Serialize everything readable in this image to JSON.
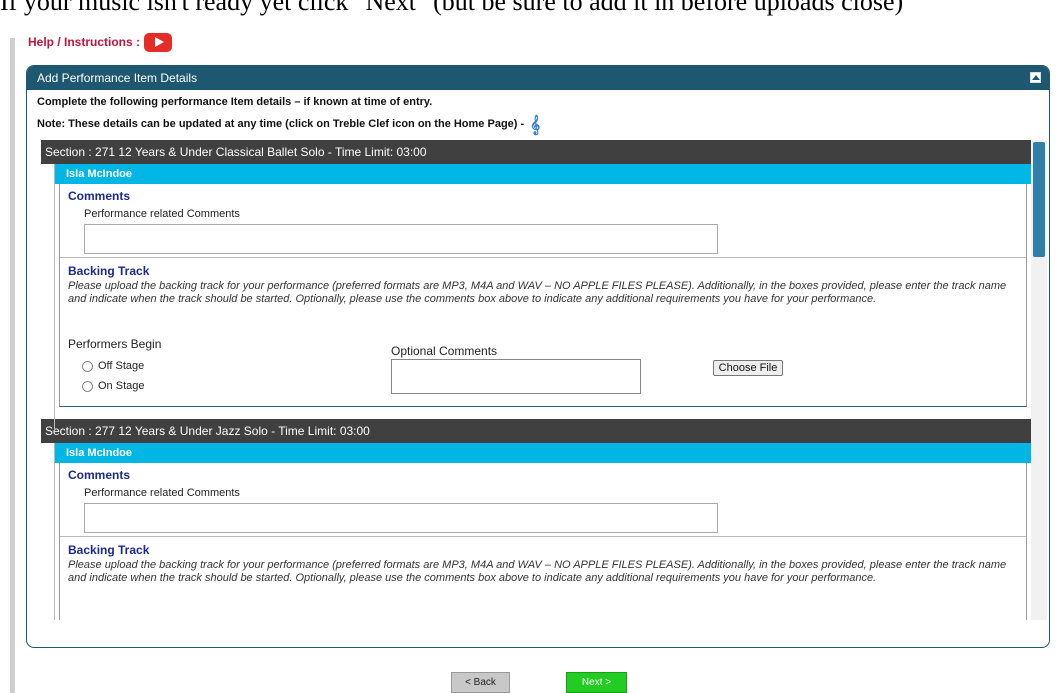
{
  "top_text": "If your music isn't ready yet click \"Next\" (but be sure to add it in before uploads close)",
  "help": {
    "label": "Help / Instructions :"
  },
  "panel": {
    "title": "Add Performance Item Details",
    "intro1": "Complete the following performance Item details – if known at time of entry.",
    "intro2": "Note: These details can be updated at any time (click on Treble Clef icon on the Home Page) -"
  },
  "sections": [
    {
      "header": "Section : 271 12 Years & Under Classical Ballet Solo - Time Limit: 03:00",
      "performer": "Isla McIndoe",
      "comments_title": "Comments",
      "comments_label": "Performance related Comments",
      "backing_title": "Backing Track",
      "backing_desc": "Please upload the backing track for your performance (preferred formats are MP3, M4A and WAV – NO APPLE FILES PLEASE). Additionally, in the boxes provided, please enter the track name and indicate when the track should be started. Optionally, please use the comments box above to indicate any additional requirements you have for your performance.",
      "performers_begin": "Performers Begin",
      "options": [
        "Off Stage",
        "On Stage"
      ],
      "optional_comments": "Optional Comments",
      "choose_file": "Choose File"
    },
    {
      "header": "Section : 277 12 Years & Under Jazz Solo - Time Limit: 03:00",
      "performer": "Isla McIndoe",
      "comments_title": "Comments",
      "comments_label": "Performance related Comments",
      "backing_title": "Backing Track",
      "backing_desc": "Please upload the backing track for your performance (preferred formats are MP3, M4A and WAV – NO APPLE FILES PLEASE). Additionally, in the boxes provided, please enter the track name and indicate when the track should be started. Optionally, please use the comments box above to indicate any additional requirements you have for your performance."
    }
  ],
  "buttons": {
    "back": "< Back",
    "next": "Next >"
  },
  "colors": {
    "panel_header": "#1e5870",
    "section_header": "#404040",
    "performer_bar": "#00b6e4",
    "next_button": "#22cc22",
    "help_text": "#c0143c"
  }
}
